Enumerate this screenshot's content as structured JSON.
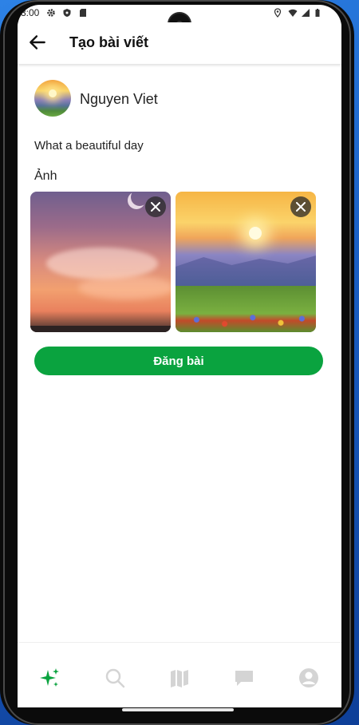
{
  "status_bar": {
    "time": "3:00",
    "left_icons": [
      "settings-icon",
      "shield-icon",
      "sd-card-icon"
    ],
    "right_icons": [
      "location-icon",
      "wifi-icon",
      "signal-icon",
      "battery-icon"
    ]
  },
  "header": {
    "title": "Tạo bài viết",
    "back_icon": "arrow-left-icon"
  },
  "author": {
    "name": "Nguyen Viet",
    "avatar": "sunset-landscape"
  },
  "post": {
    "text": "What a beautiful day"
  },
  "photos": {
    "label": "Ảnh",
    "items": [
      {
        "image": "pink-sunset-sky-with-clouds",
        "remove_icon": "close-icon"
      },
      {
        "image": "sunrise-over-mountain-meadow",
        "remove_icon": "close-icon"
      }
    ]
  },
  "actions": {
    "publish_label": "Đăng bài"
  },
  "bottom_nav": {
    "items": [
      {
        "icon": "sparkle-icon",
        "active": true
      },
      {
        "icon": "search-icon",
        "active": false
      },
      {
        "icon": "map-icon",
        "active": false
      },
      {
        "icon": "chat-icon",
        "active": false
      },
      {
        "icon": "account-icon",
        "active": false
      }
    ]
  },
  "colors": {
    "accent": "#0aa33f",
    "inactive_icon": "#d4d4d4",
    "text": "#222222"
  }
}
